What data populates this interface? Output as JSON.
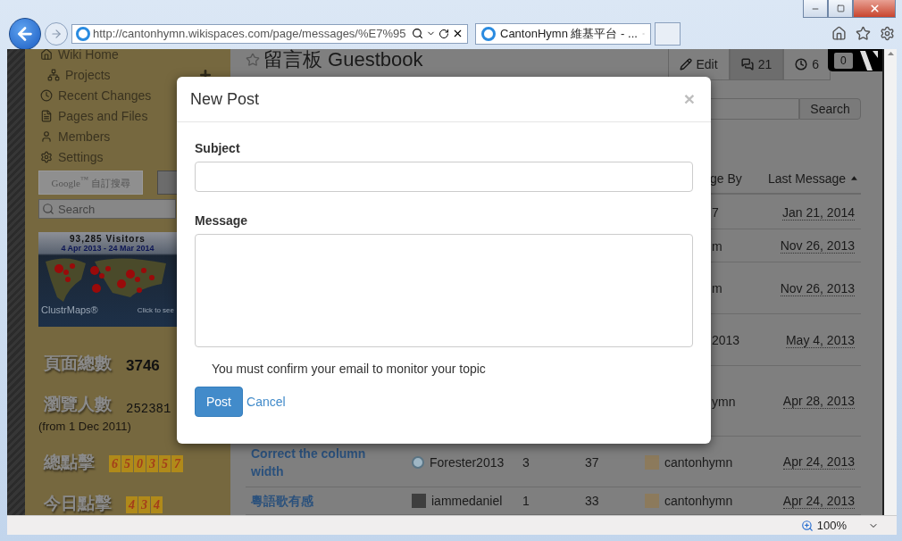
{
  "browser": {
    "address": "http://cantonhymn.wikispaces.com/page/messages/%E7%95",
    "tabs": [
      {
        "label": "CantonHymn 維基平台 - ...",
        "selected": true
      }
    ]
  },
  "sidebar": {
    "items": [
      {
        "label": "Wiki Home",
        "kind": "home",
        "children": [
          {
            "label": "Projects",
            "kind": "projects"
          }
        ]
      },
      {
        "label": "Recent Changes",
        "kind": "recent"
      },
      {
        "label": "Pages and Files",
        "kind": "pages"
      },
      {
        "label": "Members",
        "kind": "members"
      },
      {
        "label": "Settings",
        "kind": "settings"
      }
    ],
    "google_search": "Google$^{™}$ 自訂搜尋",
    "search": {
      "placeholder": "Search"
    },
    "map_widget": {
      "visitors": "93,285 Visitors",
      "range": "4 Apr 2013 - 24 Mar 2014",
      "brand": "ClustrMaps®",
      "hint": "Click to see"
    },
    "stats": [
      {
        "label": "頁面總數",
        "value": "3746",
        "kind": "bold"
      },
      {
        "label": "瀏覽人數",
        "value": "252381",
        "kind": "plain",
        "note": "(from 1 Dec 2011)"
      },
      {
        "label": "總點擊",
        "digits": [
          "6",
          "5",
          "0",
          "3",
          "5",
          "7"
        ],
        "kind": "digits"
      },
      {
        "label": "今日點擊",
        "digits": [
          "4",
          "3",
          "4"
        ],
        "kind": "digits"
      }
    ]
  },
  "page": {
    "title": "留言板 Guestbook",
    "actions": [
      {
        "label": "Edit",
        "kind": "edit",
        "selected": false
      },
      {
        "label": "21",
        "kind": "messages",
        "selected": true
      },
      {
        "label": "6",
        "kind": "history",
        "selected": false
      }
    ],
    "badge": "0",
    "search_button": "Search"
  },
  "table": {
    "columns": [
      {
        "label": "ge By",
        "sorted": false
      },
      {
        "label": "Last Message",
        "sorted": true
      }
    ],
    "rows": [
      {
        "kind": "covered",
        "last_by": "7",
        "last_message": "Jan 21, 2014"
      },
      {
        "kind": "covered",
        "last_by": "m",
        "last_message": "Nov 26, 2013"
      },
      {
        "kind": "covered",
        "last_by": "m",
        "last_message": "Nov 26, 2013"
      },
      {
        "kind": "covered",
        "last_by": "2013",
        "last_message": "May 4, 2013"
      },
      {
        "kind": "covered",
        "last_by": "ymn",
        "last_message": "Apr 28, 2013"
      },
      {
        "kind": "full",
        "topic": "Correct the column width",
        "started_by": "Forester2013",
        "avatar": {
          "kind": "round"
        },
        "replies": "3",
        "views": "37",
        "last_by": "cantonhymn",
        "last_message": "Apr 24, 2013"
      },
      {
        "kind": "full",
        "topic": "粵語歌有感",
        "started_by": "iammedaniel",
        "avatar": {
          "kind": "square"
        },
        "replies": "1",
        "views": "33",
        "last_by": "cantonhymn",
        "last_message": "Apr 24, 2013"
      }
    ]
  },
  "modal": {
    "title": "New Post",
    "close": "×",
    "fields": [
      {
        "label": "Subject",
        "kind": "input"
      },
      {
        "label": "Message",
        "kind": "textarea"
      }
    ],
    "notice": "You must confirm your email to monitor your topic",
    "primary": "Post",
    "secondary": "Cancel"
  },
  "status_bar": {
    "zoom": "100%"
  }
}
